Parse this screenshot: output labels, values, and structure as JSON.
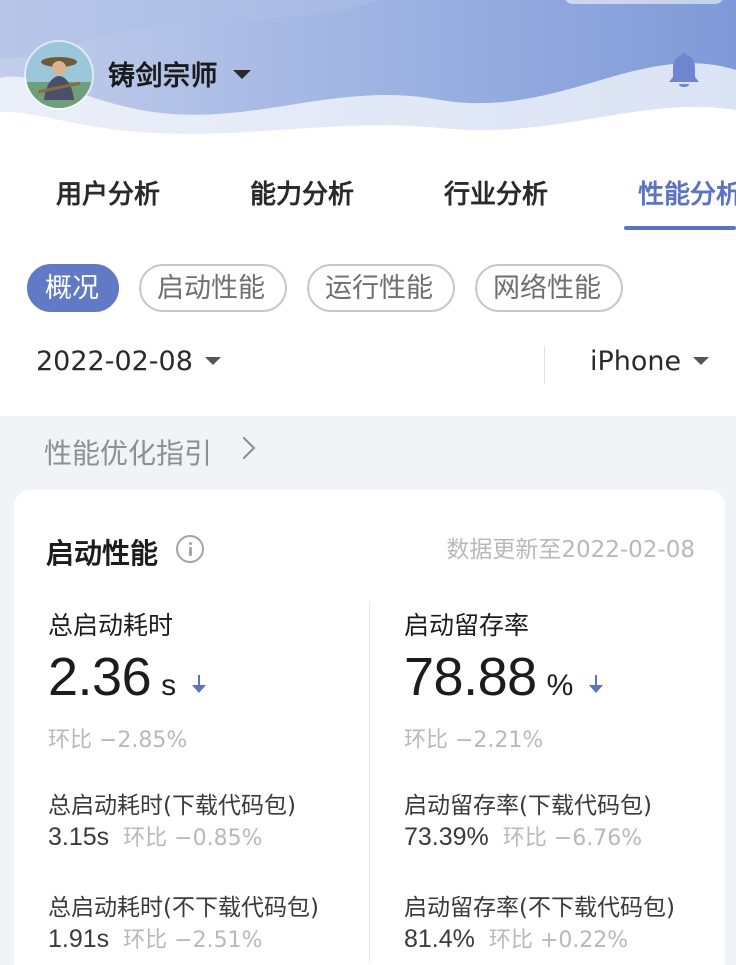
{
  "header": {
    "user_name": "铸剑宗师",
    "colors": {
      "wave_light": "#dfe7f5",
      "wave_mid": "#b9c9ea",
      "wave_deep": "#8ea8df"
    }
  },
  "main_tabs": [
    {
      "label": "用户分析",
      "active": false
    },
    {
      "label": "能力分析",
      "active": false
    },
    {
      "label": "行业分析",
      "active": false
    },
    {
      "label": "性能分析",
      "active": true
    }
  ],
  "sub_tabs": [
    {
      "label": "概况",
      "active": true
    },
    {
      "label": "启动性能",
      "active": false
    },
    {
      "label": "运行性能",
      "active": false
    },
    {
      "label": "网络性能",
      "active": false
    }
  ],
  "filters": {
    "date": "2022-02-08",
    "device": "iPhone"
  },
  "guide_link": "性能优化指引",
  "card": {
    "title": "启动性能",
    "update_note": "数据更新至2022-02-08",
    "metrics": [
      {
        "label": "总启动耗时",
        "value": "2.36",
        "unit": "s",
        "trend": "down",
        "compare": "环比 −2.85%",
        "subs": [
          {
            "label": "总启动耗时(下载代码包)",
            "value": "3.15s",
            "compare": "环比 −0.85%"
          },
          {
            "label": "总启动耗时(不下载代码包)",
            "value": "1.91s",
            "compare": "环比 −2.51%"
          }
        ]
      },
      {
        "label": "启动留存率",
        "value": "78.88",
        "unit": "%",
        "trend": "down",
        "compare": "环比 −2.21%",
        "subs": [
          {
            "label": "启动留存率(下载代码包)",
            "value": "73.39%",
            "compare": "环比 −6.76%"
          },
          {
            "label": "启动留存率(不下载代码包)",
            "value": "81.4%",
            "compare": "环比 +0.22%"
          }
        ]
      }
    ]
  },
  "accent_color": "#5b73c4",
  "icons": [
    "avatar-image",
    "chevron-down-icon",
    "bell-icon",
    "info-icon",
    "chevron-right-icon",
    "arrow-down-icon"
  ]
}
